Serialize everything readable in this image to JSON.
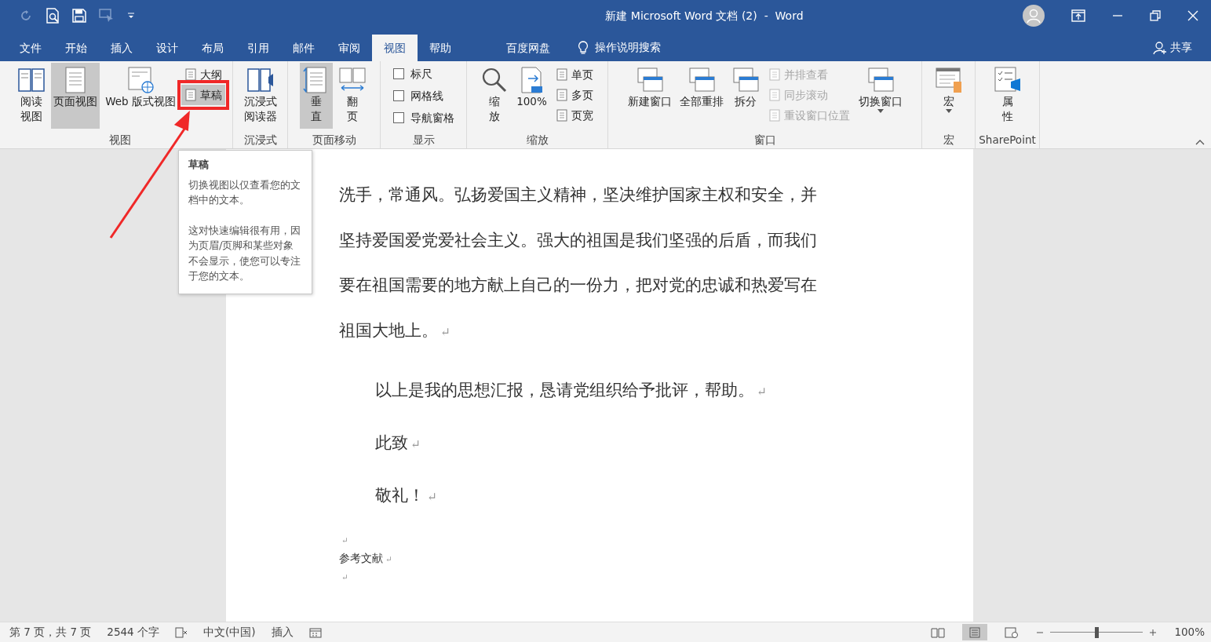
{
  "window": {
    "title": "新建 Microsoft Word 文档 (2)  -  Word"
  },
  "tabs": [
    {
      "label": "文件",
      "selected": false
    },
    {
      "label": "开始",
      "selected": false
    },
    {
      "label": "插入",
      "selected": false
    },
    {
      "label": "设计",
      "selected": false
    },
    {
      "label": "布局",
      "selected": false
    },
    {
      "label": "引用",
      "selected": false
    },
    {
      "label": "邮件",
      "selected": false
    },
    {
      "label": "审阅",
      "selected": false
    },
    {
      "label": "视图",
      "selected": true
    },
    {
      "label": "帮助",
      "selected": false
    },
    {
      "label": "百度网盘",
      "selected": false
    }
  ],
  "tell_me": {
    "label": "操作说明搜索"
  },
  "share": {
    "label": "共享"
  },
  "ribbon_groups": [
    {
      "label": "视图",
      "columns": [
        [
          {
            "kind": "large",
            "lines": [
              "阅读",
              "视图"
            ],
            "selected": false
          }
        ],
        [
          {
            "kind": "large",
            "lines": [
              "页面视图"
            ],
            "selected": true
          }
        ],
        [
          {
            "kind": "large",
            "lines": [
              "Web 版式视图"
            ],
            "selected": false
          }
        ],
        [
          {
            "kind": "small",
            "label": "大纲",
            "selected": false
          },
          {
            "kind": "small",
            "label": "草稿",
            "selected": true
          }
        ]
      ]
    },
    {
      "label": "沉浸式",
      "columns": [
        [
          {
            "kind": "large",
            "lines": [
              "沉浸式",
              "阅读器"
            ],
            "selected": false
          }
        ]
      ]
    },
    {
      "label": "页面移动",
      "columns": [
        [
          {
            "kind": "large",
            "lines": [
              "垂",
              "直"
            ],
            "selected": true
          }
        ],
        [
          {
            "kind": "large",
            "lines": [
              "翻",
              "页"
            ],
            "selected": false
          }
        ]
      ]
    },
    {
      "label": "显示",
      "columns": [
        [
          {
            "kind": "checkbox",
            "label": "标尺",
            "checked": false
          },
          {
            "kind": "checkbox",
            "label": "网格线",
            "checked": false
          },
          {
            "kind": "checkbox",
            "label": "导航窗格",
            "checked": false
          }
        ]
      ]
    },
    {
      "label": "缩放",
      "columns": [
        [
          {
            "kind": "large",
            "lines": [
              "缩",
              "放"
            ],
            "selected": false
          }
        ],
        [
          {
            "kind": "large",
            "lines": [
              "100%"
            ],
            "selected": false
          }
        ],
        [
          {
            "kind": "small",
            "label": "单页",
            "selected": false
          },
          {
            "kind": "small",
            "label": "多页",
            "selected": false
          },
          {
            "kind": "small",
            "label": "页宽",
            "selected": false
          }
        ]
      ]
    },
    {
      "label": "窗口",
      "columns": [
        [
          {
            "kind": "large",
            "lines": [
              "新建窗口"
            ],
            "selected": false
          }
        ],
        [
          {
            "kind": "large",
            "lines": [
              "全部重排"
            ],
            "selected": false
          }
        ],
        [
          {
            "kind": "large",
            "lines": [
              "拆分"
            ],
            "selected": false
          }
        ],
        [
          {
            "kind": "small",
            "label": "并排查看",
            "disabled": true
          },
          {
            "kind": "small",
            "label": "同步滚动",
            "disabled": true
          },
          {
            "kind": "small",
            "label": "重设窗口位置",
            "disabled": true
          }
        ],
        [
          {
            "kind": "dropdown",
            "lines": [
              "切换窗口"
            ],
            "selected": false
          }
        ]
      ]
    },
    {
      "label": "宏",
      "columns": [
        [
          {
            "kind": "dropdown",
            "lines": [
              "宏"
            ],
            "selected": false
          }
        ]
      ]
    },
    {
      "label": "SharePoint",
      "columns": [
        [
          {
            "kind": "large",
            "lines": [
              "属",
              "性"
            ],
            "selected": false
          }
        ]
      ]
    }
  ],
  "tooltip": {
    "title": "草稿",
    "paragraphs": [
      "切换视图以仅查看您的文档中的文本。",
      "这对快速编辑很有用，因为页眉/页脚和某些对象不会显示，使您可以专注于您的文本。"
    ]
  },
  "document": [
    {
      "kind": "body",
      "text": "洗手，常通风。弘扬爱国主义精神，坚决维护国家主权和安全，并"
    },
    {
      "kind": "body",
      "text": "坚持爱国爱党爱社会主义。强大的祖国是我们坚强的后盾，而我们"
    },
    {
      "kind": "body",
      "text": "要在祖国需要的地方献上自己的一份力，把对党的忠诚和热爱写在"
    },
    {
      "kind": "body",
      "text": "祖国大地上。",
      "mark": "↵"
    },
    {
      "kind": "indent",
      "text": "以上是我的思想汇报，恳请党组织给予批评，帮助。",
      "mark": "↵"
    },
    {
      "kind": "indent",
      "text": "此致",
      "mark": "↵"
    },
    {
      "kind": "indent",
      "text": "敬礼！",
      "mark": "↵"
    },
    {
      "kind": "small",
      "mark": "↵"
    },
    {
      "kind": "small",
      "text": "参考文献",
      "mark": "↵"
    },
    {
      "kind": "small",
      "mark": "↵"
    }
  ],
  "status_bar": {
    "page": "第 7 页，共 7 页",
    "words": "2544 个字",
    "language": "中文(中国)",
    "mode": "插入",
    "zoom": {
      "level": 0.5,
      "reading": "100%"
    }
  }
}
